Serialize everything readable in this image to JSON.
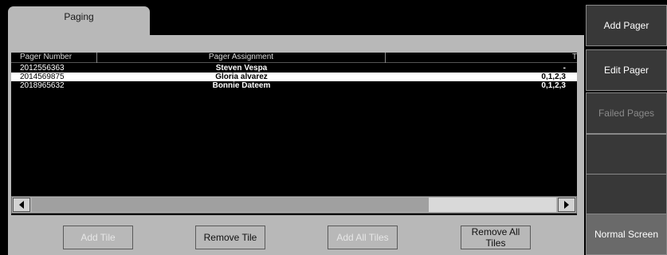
{
  "tab": {
    "label": "Paging"
  },
  "table": {
    "columns": [
      "Pager Number",
      "Pager Assignment",
      "Ti"
    ],
    "rows": [
      {
        "number": "2012556363",
        "assignment": "Steven Vespa",
        "tiles": "-",
        "selected": false
      },
      {
        "number": "2014569875",
        "assignment": "Gloria alvarez",
        "tiles": "0,1,2,3",
        "selected": true
      },
      {
        "number": "2018965632",
        "assignment": "Bonnie Dateem",
        "tiles": "0,1,2,3",
        "selected": false
      }
    ]
  },
  "buttons": {
    "add_tile": "Add Tile",
    "remove_tile": "Remove Tile",
    "add_all_tiles": "Add All Tiles",
    "remove_all_tiles": "Remove All Tiles"
  },
  "side_menu": {
    "add_pager": "Add Pager",
    "edit_pager": "Edit Pager",
    "failed_pages": "Failed Pages",
    "blank_1": "",
    "blank_2": "",
    "normal_screen": "Normal Screen"
  }
}
